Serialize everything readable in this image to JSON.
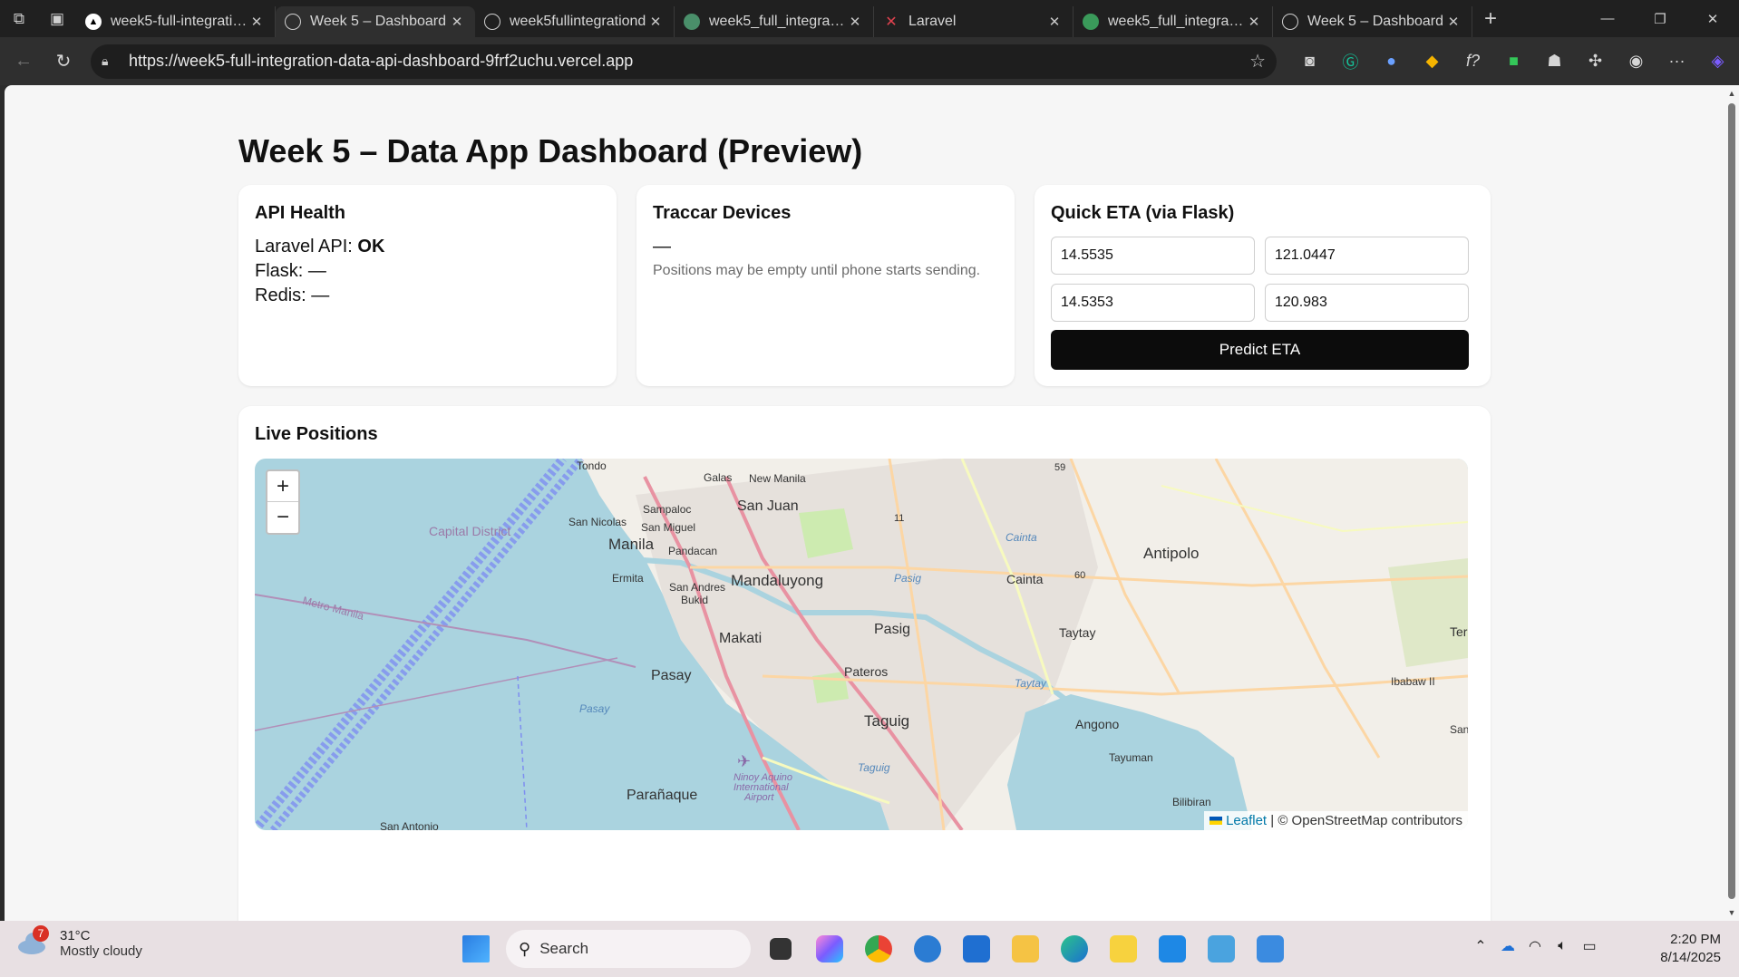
{
  "browser": {
    "tabs": [
      {
        "title": "week5-full-integration",
        "icon": "vercel-icon",
        "active": false
      },
      {
        "title": "Week 5 – Dashboard",
        "icon": "globe-icon",
        "active": true
      },
      {
        "title": "week5fullintegrationd",
        "icon": "globe-icon",
        "active": false
      },
      {
        "title": "week5_full_integration",
        "icon": "render-icon",
        "active": false
      },
      {
        "title": "Laravel",
        "icon": "laravel-icon",
        "active": false
      },
      {
        "title": "week5_full_integration",
        "icon": "railway-icon",
        "active": false
      },
      {
        "title": "Week 5 – Dashboard",
        "icon": "globe-icon",
        "active": false
      }
    ],
    "url": "https://week5-full-integration-data-api-dashboard-9frf2uchu.vercel.app"
  },
  "page": {
    "title": "Week 5 – Data App Dashboard (Preview)",
    "api_health": {
      "heading": "API Health",
      "laravel_label": "Laravel API: ",
      "laravel_status": "OK",
      "flask_label": "Flask: ",
      "flask_status": "—",
      "redis_label": "Redis: ",
      "redis_status": "—"
    },
    "traccar": {
      "heading": "Traccar Devices",
      "value": "—",
      "note": "Positions may be empty until phone starts sending."
    },
    "eta": {
      "heading": "Quick ETA (via Flask)",
      "origin_lat": "14.5535",
      "origin_lng": "121.0447",
      "dest_lat": "14.5353",
      "dest_lng": "120.983",
      "button": "Predict ETA"
    },
    "live": {
      "heading": "Live Positions",
      "zoom_in": "+",
      "zoom_out": "−",
      "attribution_link": "Leaflet",
      "attribution_text": " | © OpenStreetMap contributors",
      "labels": {
        "tondo": "Tondo",
        "galas": "Galas",
        "new_manila": "New Manila",
        "san_juan": "San Juan",
        "sampaloc": "Sampaloc",
        "san_nicolas": "San Nicolas",
        "san_miguel": "San Miguel",
        "capital_district": "Capital District",
        "manila": "Manila",
        "pandacan": "Pandacan",
        "ermita": "Ermita",
        "san_andres": "San Andres",
        "bukid": "Bukid",
        "mandaluyong": "Mandaluyong",
        "metro_manila": "Metro Manila",
        "makati": "Makati",
        "pasig": "Pasig",
        "pasig_river": "Pasig",
        "cainta": "Cainta",
        "cainta_italic": "Cainta",
        "antipolo": "Antipolo",
        "taytay": "Taytay",
        "taytay_italic": "Taytay",
        "ter": "Ter",
        "ibabaw": "Ibabaw II",
        "pateros": "Pateros",
        "pasay": "Pasay",
        "pasay_italic": "Pasay",
        "taguig": "Taguig",
        "taguig_italic": "Taguig",
        "angono": "Angono",
        "san": "San",
        "tayuman": "Tayuman",
        "ninoy": "Ninoy Aquino",
        "intl": "International",
        "airport": "Airport",
        "paranaque": "Parañaque",
        "bilibiran": "Bilibiran",
        "san_antonio": "San Antonio",
        "r59": "59",
        "r11": "11",
        "r60": "60"
      }
    }
  },
  "taskbar": {
    "temp": "31°C",
    "condition": "Mostly cloudy",
    "weather_badge": "7",
    "search": "Search",
    "time": "2:20 PM",
    "date": "8/14/2025"
  }
}
